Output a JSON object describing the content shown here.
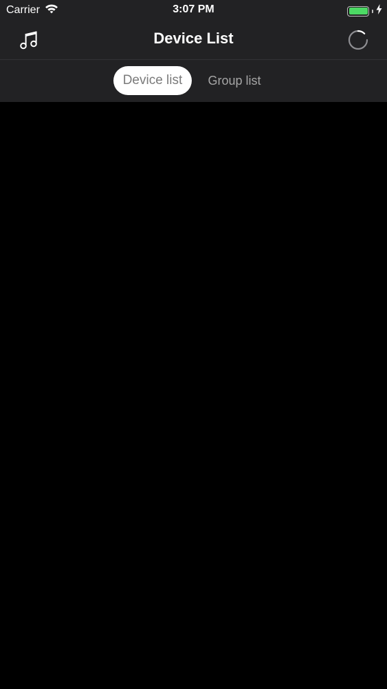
{
  "status_bar": {
    "carrier": "Carrier",
    "time": "3:07 PM",
    "battery_level": 1.0,
    "battery_color": "#4cd964"
  },
  "nav": {
    "title": "Device List",
    "left_icon": "music-note-icon",
    "right_icon": "loading-spinner-icon"
  },
  "tabs": {
    "items": [
      {
        "label": "Device list",
        "selected": true
      },
      {
        "label": "Group list",
        "selected": false
      }
    ]
  },
  "colors": {
    "header_bg": "#222224",
    "content_bg": "#000000",
    "selected_tab_bg": "#ffffff"
  }
}
